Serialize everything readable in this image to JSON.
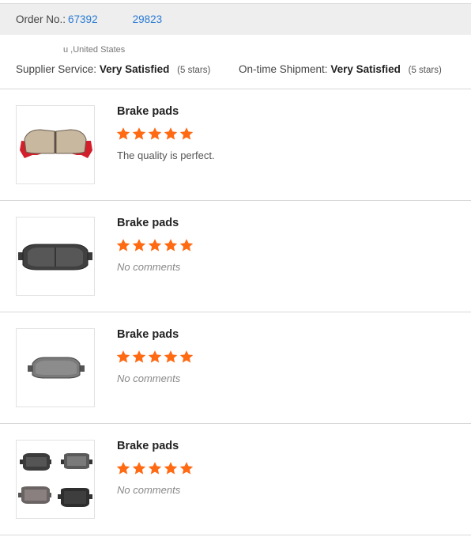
{
  "order": {
    "label": "Order No.:",
    "number_start": "67392",
    "number_end": "29823"
  },
  "buyer": {
    "country_suffix": "u ,United States"
  },
  "ratings": {
    "supplier_label": "Supplier Service:",
    "supplier_value": "Very Satisfied",
    "supplier_stars": "(5 stars)",
    "shipment_label": "On-time Shipment:",
    "shipment_value": "Very Satisfied",
    "shipment_stars": "(5 stars)"
  },
  "star_color": "#ff6a13",
  "items": [
    {
      "title": "Brake pads",
      "rating": 5,
      "comment": "The quality is perfect.",
      "image": "red-caliper-brake-pad-icon"
    },
    {
      "title": "Brake pads",
      "rating": 5,
      "comment": "No comments",
      "image": "dark-brake-pad-icon"
    },
    {
      "title": "Brake pads",
      "rating": 5,
      "comment": "No comments",
      "image": "grey-brake-pad-icon"
    },
    {
      "title": "Brake pads",
      "rating": 5,
      "comment": "No comments",
      "image": "brake-pad-set-icon"
    }
  ]
}
